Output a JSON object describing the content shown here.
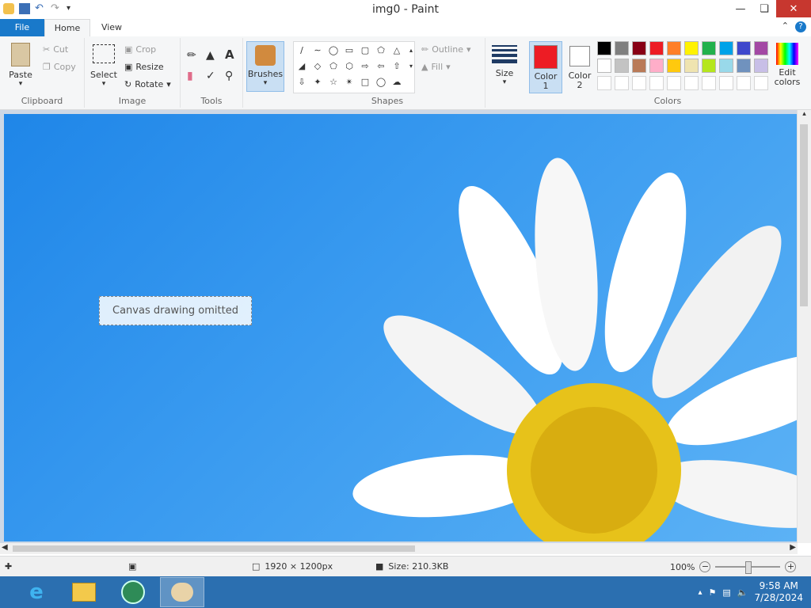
{
  "window": {
    "title": "img0 - Paint"
  },
  "tabs": {
    "file": "File",
    "home": "Home",
    "view": "View"
  },
  "clipboard": {
    "paste": "Paste",
    "cut": "Cut",
    "copy": "Copy",
    "label": "Clipboard"
  },
  "image": {
    "select": "Select",
    "crop": "Crop",
    "resize": "Resize",
    "rotate": "Rotate",
    "label": "Image"
  },
  "tools": {
    "label": "Tools"
  },
  "brushes": {
    "label": "Brushes"
  },
  "shapes": {
    "outline": "Outline",
    "fill": "Fill",
    "label": "Shapes"
  },
  "size": {
    "label": "Size"
  },
  "colors": {
    "color1": "Color 1",
    "color2": "Color 2",
    "edit": "Edit colors",
    "label": "Colors",
    "color1_value": "#ed1c24",
    "color2_value": "#ffffff",
    "palette_row1": [
      "#000000",
      "#7f7f7f",
      "#880015",
      "#ed1c24",
      "#ff7f27",
      "#fff200",
      "#22b14c",
      "#00a2e8",
      "#3f48cc",
      "#a349a4"
    ],
    "palette_row2": [
      "#ffffff",
      "#c3c3c3",
      "#b97a57",
      "#ffaec9",
      "#ffc90e",
      "#efe4b0",
      "#b5e61d",
      "#99d9ea",
      "#7092be",
      "#c8bfe7"
    ]
  },
  "canvas": {
    "note": "Canvas drawing omitted"
  },
  "status": {
    "dimensions": "1920 × 1200px",
    "size": "Size: 210.3KB",
    "zoom": "100%"
  },
  "clock": {
    "time": "9:58 AM",
    "date": "7/28/2024"
  }
}
